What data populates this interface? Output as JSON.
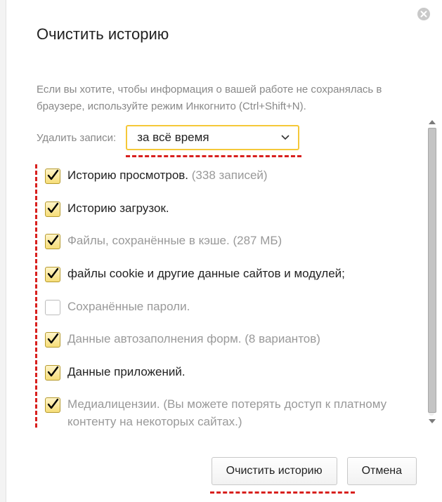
{
  "dialog": {
    "title": "Очистить историю",
    "intro": "Если вы хотите, чтобы информация о вашей работе не сохранялась в браузере, используйте режим Инкогнито (Ctrl+Shift+N).",
    "delete_label": "Удалить записи:",
    "select_value": "за всё время"
  },
  "options": [
    {
      "checked": true,
      "label": "Историю просмотров.",
      "detail": "(338 записей)",
      "muted": false
    },
    {
      "checked": true,
      "label": "Историю загрузок.",
      "detail": "",
      "muted": false
    },
    {
      "checked": true,
      "label": "Файлы, сохранённые в кэше.",
      "detail": "(287 МБ)",
      "muted": true
    },
    {
      "checked": true,
      "label": "файлы cookie и другие данные сайтов и модулей;",
      "detail": "",
      "muted": false
    },
    {
      "checked": false,
      "label": "Сохранённые пароли.",
      "detail": "",
      "muted": true
    },
    {
      "checked": true,
      "label": "Данные автозаполнения форм.",
      "detail": "(8 вариантов)",
      "muted": true
    },
    {
      "checked": true,
      "label": "Данные приложений.",
      "detail": "",
      "muted": false
    },
    {
      "checked": true,
      "label": "Медиалицензии.",
      "detail": "(Вы можете потерять доступ к платному контенту на некоторых сайтах.)",
      "muted": true
    }
  ],
  "footer": {
    "primary": "Очистить историю",
    "cancel": "Отмена"
  }
}
